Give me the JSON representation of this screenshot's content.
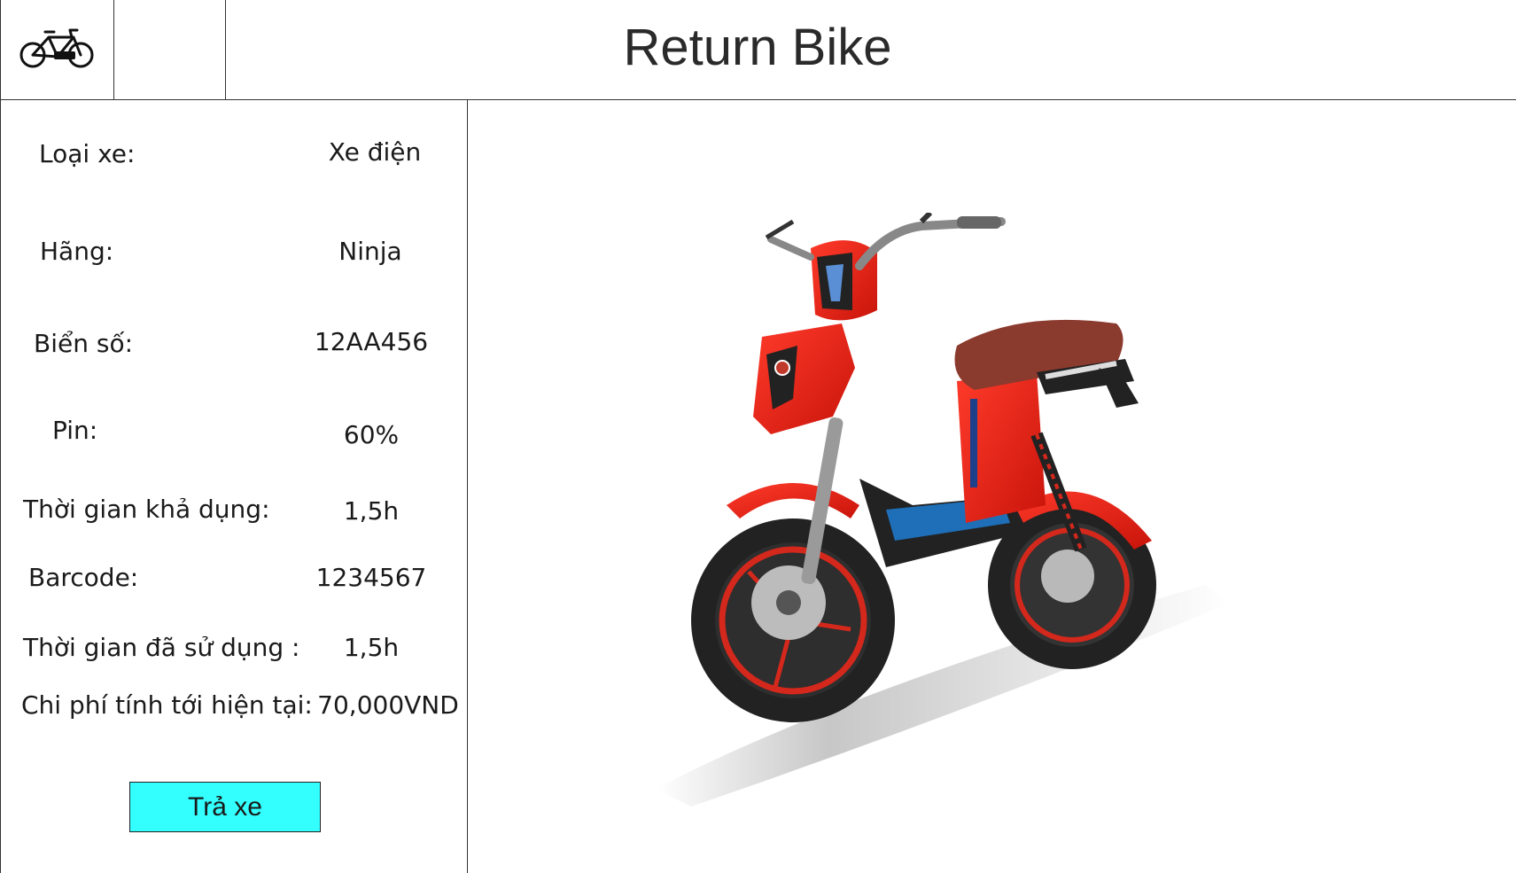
{
  "header": {
    "title": "Return Bike",
    "logo_icon": "bicycle-icon"
  },
  "details": [
    {
      "label": "Loại xe:",
      "value": "Xe điện"
    },
    {
      "label": "Hãng:",
      "value": "Ninja"
    },
    {
      "label": "Biển số:",
      "value": "12AA456"
    },
    {
      "label": "Pin:",
      "value": "60%"
    },
    {
      "label": "Thời gian khả dụng:",
      "value": "1,5h"
    },
    {
      "label": "Barcode:",
      "value": "1234567"
    },
    {
      "label": "Thời gian đã sử dụng :",
      "value": "1,5h"
    },
    {
      "label": "Chi phí tính tới hiện tại:",
      "value": "70,000VND"
    }
  ],
  "actions": {
    "return_label": "Trả xe"
  },
  "colors": {
    "button_bg": "#33ffff",
    "bike_body": "#e41e12",
    "seat": "#8b3a2e"
  }
}
